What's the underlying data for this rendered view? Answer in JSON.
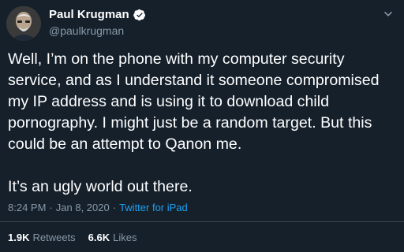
{
  "author": {
    "display_name": "Paul Krugman",
    "handle": "@paulkrugman",
    "verified_icon": "verified-badge-icon",
    "badge_color": "#1da1f2"
  },
  "tweet": {
    "text": "Well, I’m on the phone with my computer security service, and as I understand it someone compromised my IP address and is using it to download child pornography. I might just be a random target. But this could be an attempt to Qanon me.\n\nIt’s an ugly world out there.",
    "time": "8:24 PM",
    "separator": "·",
    "date": "Jan 8, 2020",
    "source": "Twitter for iPad"
  },
  "stats": {
    "retweets_count": "1.9K",
    "retweets_label": "Retweets",
    "likes_count": "6.6K",
    "likes_label": "Likes"
  },
  "colors": {
    "background": "#15202b",
    "text": "#ffffff",
    "secondary": "#8899a6",
    "accent": "#1da1f2",
    "divider": "#38444d"
  },
  "icons": {
    "more": "chevron-down-icon"
  }
}
